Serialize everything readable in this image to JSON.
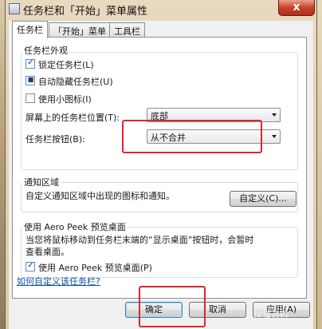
{
  "window": {
    "title": "任务栏和「开始」菜单属性",
    "close_label": "x"
  },
  "tabs": [
    {
      "label": "任务栏"
    },
    {
      "label": "「开始」菜单"
    },
    {
      "label": "工具栏"
    }
  ],
  "appearance": {
    "heading": "任务栏外观",
    "lock": {
      "label": "锁定任务栏(L)",
      "checked": true
    },
    "autohide": {
      "label": "自动隐藏任务栏(U)",
      "checked": true
    },
    "small_icons": {
      "label": "使用小图标(I)",
      "checked": false
    },
    "position": {
      "label": "屏幕上的任务栏位置(T):",
      "value": "底部"
    },
    "buttons": {
      "label": "任务栏按钮(B):",
      "value": "从不合并"
    }
  },
  "notify": {
    "heading": "通知区域",
    "description": "自定义通知区域中出现的图标和通知。",
    "customize_button": "自定义(C)..."
  },
  "aero": {
    "heading": "使用 Aero Peek 预览桌面",
    "description_line1": "当您将鼠标移动到任务栏末端的“显示桌面”按钮时，会暂时",
    "description_line2": "查看桌面。",
    "checkbox": {
      "label": "使用 Aero Peek 预览桌面(P)",
      "checked": true
    }
  },
  "help_link": "如何自定义该任务栏?",
  "footer": {
    "ok": "确定",
    "cancel": "取消",
    "apply": "应用(A)"
  },
  "watermark": "快懂百科",
  "colors": {
    "annotation": "#e0252f",
    "link": "#0b4fa8",
    "close": "#c7432b"
  }
}
